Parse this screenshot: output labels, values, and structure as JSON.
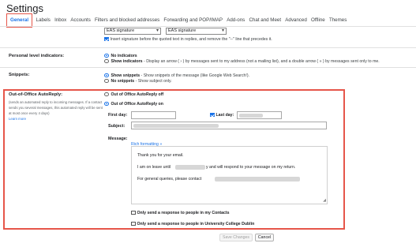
{
  "header": {
    "title": "Settings"
  },
  "tabs": [
    {
      "label": "General",
      "active": true
    },
    {
      "label": "Labels"
    },
    {
      "label": "Inbox"
    },
    {
      "label": "Accounts"
    },
    {
      "label": "Filters and blocked addresses"
    },
    {
      "label": "Forwarding and POP/IMAP"
    },
    {
      "label": "Add-ons"
    },
    {
      "label": "Chat and Meet"
    },
    {
      "label": "Advanced"
    },
    {
      "label": "Offline"
    },
    {
      "label": "Themes"
    }
  ],
  "signature": {
    "select_1": "EAS signature",
    "select_2": "EAS signature",
    "insert_checkbox_checked": true,
    "insert_text": "Insert signature before the quoted text in replies, and remove the \"--\" line that precedes it."
  },
  "personal_indicators": {
    "label": "Personal level indicators:",
    "option_off": "No indicators",
    "option_on_label": "Show indicators",
    "option_on_desc": " - Display an arrow ( › ) by messages sent to my address (not a mailing list), and a double arrow ( » ) by messages sent only to me.",
    "selected": "No indicators"
  },
  "snippets": {
    "label": "Snippets:",
    "option_on_label": "Show snippets",
    "option_on_desc": " - Show snippets of the message (like Google Web Search!).",
    "option_off_label": "No snippets",
    "option_off_desc": " - Show subject only.",
    "selected": "Show snippets"
  },
  "ooo": {
    "label": "Out-of-Office AutoReply:",
    "helper": "(sends an automated reply to incoming messages. If a contact sends you several messages, this automated reply will be sent at most once every 4 days)",
    "learn_more": "Learn more",
    "option_off": "Out of Office AutoReply off",
    "option_on": "Out of Office AutoReply on",
    "selected": "Out of Office AutoReply on",
    "first_day_label": "First day:",
    "last_day_label": "Last day:",
    "last_day_checked": true,
    "subject_label": "Subject:",
    "message_label": "Message:",
    "rich_formatting_link": "Rich formatting »",
    "message_lines": [
      "Thank you for your email.",
      "I am on leave until",
      "y and will respond to your message on my return.",
      "For general queries, please contact"
    ],
    "only_contacts_label": "Only send a response to people in my Contacts",
    "only_org_label": "Only send a response to people in University College Dublin"
  },
  "footer": {
    "save_label": "Save Changes",
    "cancel_label": "Cancel"
  },
  "colors": {
    "accent": "#1a73e8",
    "highlight_border": "#e6564a"
  }
}
